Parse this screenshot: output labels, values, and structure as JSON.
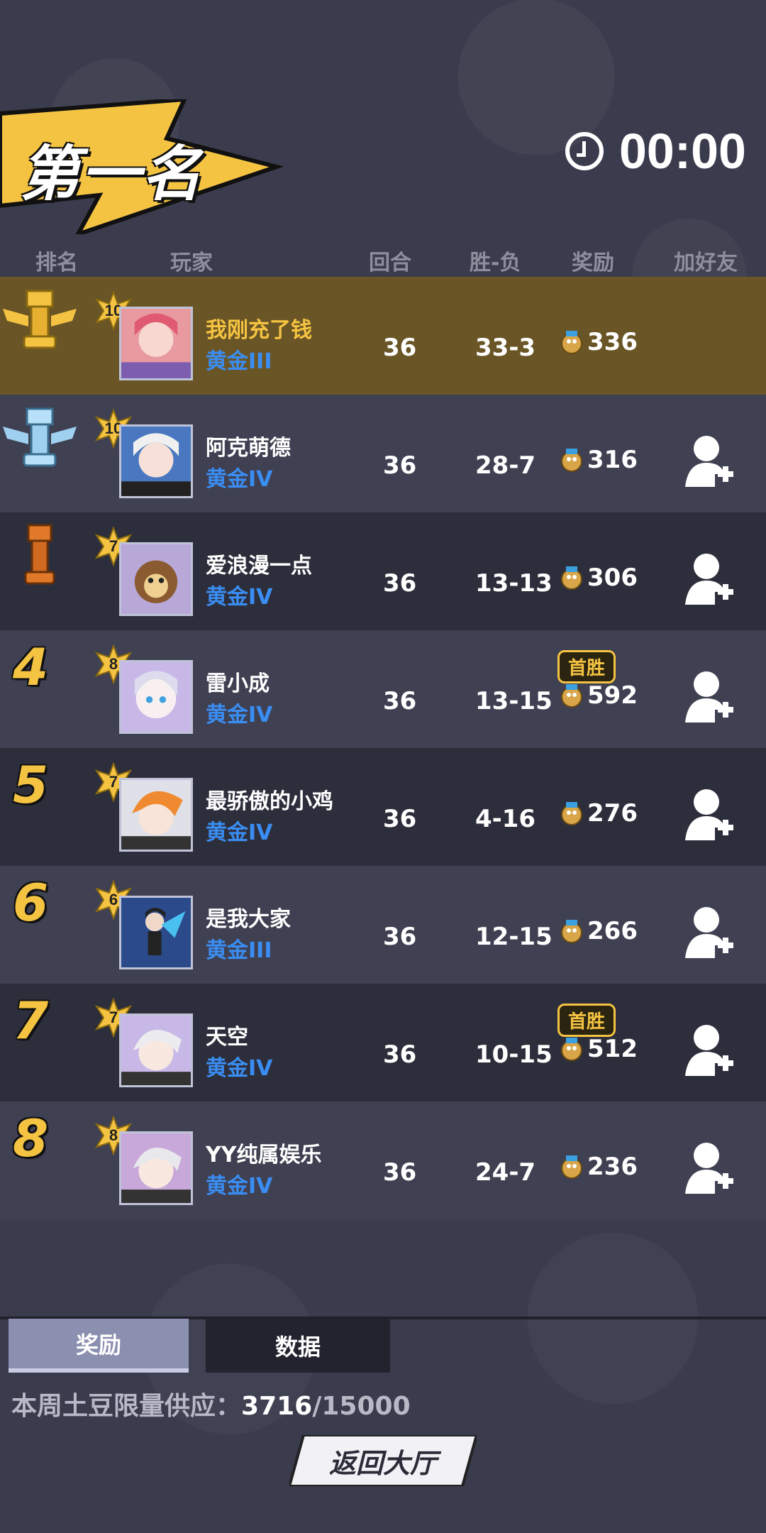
{
  "header": {
    "rank_title": "第一名",
    "timer": "00:00"
  },
  "columns": {
    "rank": "排名",
    "player": "玩家",
    "rounds": "回合",
    "win_loss": "胜-负",
    "reward": "奖励",
    "add_friend": "加好友"
  },
  "players": [
    {
      "rank": "1",
      "level": "10",
      "name": "我刚充了钱",
      "tier": "黄金III",
      "rounds": "36",
      "wl": "33-3",
      "reward": "336",
      "first_win": "",
      "trophy": "gold"
    },
    {
      "rank": "2",
      "level": "10",
      "name": "阿克萌德",
      "tier": "黄金IV",
      "rounds": "36",
      "wl": "28-7",
      "reward": "316",
      "first_win": "",
      "trophy": "silver"
    },
    {
      "rank": "3",
      "level": "7",
      "name": "爱浪漫一点",
      "tier": "黄金IV",
      "rounds": "36",
      "wl": "13-13",
      "reward": "306",
      "first_win": "",
      "trophy": "bronze"
    },
    {
      "rank": "4",
      "level": "8",
      "name": "雷小成",
      "tier": "黄金IV",
      "rounds": "36",
      "wl": "13-15",
      "reward": "592",
      "first_win": "首胜",
      "trophy": ""
    },
    {
      "rank": "5",
      "level": "7",
      "name": "最骄傲的小鸡",
      "tier": "黄金IV",
      "rounds": "36",
      "wl": "4-16",
      "reward": "276",
      "first_win": "",
      "trophy": ""
    },
    {
      "rank": "6",
      "level": "6",
      "name": "是我大家",
      "tier": "黄金III",
      "rounds": "36",
      "wl": "12-15",
      "reward": "266",
      "first_win": "",
      "trophy": ""
    },
    {
      "rank": "7",
      "level": "7",
      "name": "天空",
      "tier": "黄金IV",
      "rounds": "36",
      "wl": "10-15",
      "reward": "512",
      "first_win": "首胜",
      "trophy": ""
    },
    {
      "rank": "8",
      "level": "8",
      "name": "YY纯属娱乐",
      "tier": "黄金IV",
      "rounds": "36",
      "wl": "24-7",
      "reward": "236",
      "first_win": "",
      "trophy": ""
    }
  ],
  "tabs": {
    "reward": "奖励",
    "data": "数据"
  },
  "supply": {
    "label": "本周土豆限量供应：",
    "current": "3716",
    "total": "/15000"
  },
  "back_button": "返回大厅",
  "colors": {
    "gold": "#f5c342",
    "tier_blue": "#3a8df2",
    "highlight_row": "#6a5526"
  }
}
